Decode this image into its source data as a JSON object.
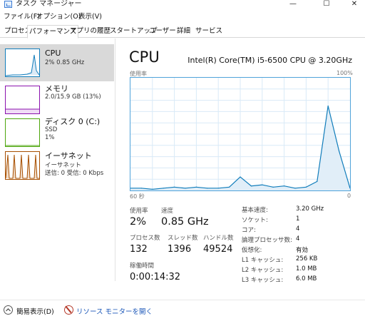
{
  "window": {
    "title": "タスク マネージャー",
    "minimize_glyph": "—",
    "maximize_glyph": "☐",
    "close_glyph": "✕"
  },
  "menu": {
    "file": "ファイル(F)",
    "options": "オプション(O)",
    "view": "表示(V)"
  },
  "tabs": [
    {
      "label": "プロセス",
      "active": false
    },
    {
      "label": "パフォーマンス",
      "active": true
    },
    {
      "label": "アプリの履歴",
      "active": false
    },
    {
      "label": "スタートアップ",
      "active": false
    },
    {
      "label": "ユーザー",
      "active": false
    },
    {
      "label": "詳細",
      "active": false
    },
    {
      "label": "サービス",
      "active": false
    }
  ],
  "sidebar": {
    "items": [
      {
        "title": "CPU",
        "sub1": "2% 0.85 GHz",
        "sub2": "",
        "color": "#117dbb",
        "icon": "cpu-graph"
      },
      {
        "title": "メモリ",
        "sub1": "2.0/15.9 GB (13%)",
        "sub2": "",
        "color": "#8b12ae",
        "icon": "memory-graph"
      },
      {
        "title": "ディスク 0 (C:)",
        "sub1": "SSD",
        "sub2": "1%",
        "color": "#4da60c",
        "icon": "disk-graph"
      },
      {
        "title": "イーサネット",
        "sub1": "イーサネット",
        "sub2": "送信: 0 受信: 0 Kbps",
        "color": "#a74f01",
        "icon": "network-graph"
      }
    ]
  },
  "main": {
    "title": "CPU",
    "cpu_model": "Intel(R) Core(TM) i5-6500 CPU @ 3.20GHz",
    "graph_top_left": "使用率",
    "graph_top_right": "100%",
    "graph_bottom_left": "60 秒",
    "graph_bottom_right": "0",
    "graph_color": "#117dbb"
  },
  "stats": {
    "usage_label": "使用率",
    "usage_value": "2%",
    "speed_label": "速度",
    "speed_value": "0.85 GHz",
    "processes_label": "プロセス数",
    "processes_value": "132",
    "threads_label": "スレッド数",
    "threads_value": "1396",
    "handles_label": "ハンドル数",
    "handles_value": "49524",
    "uptime_label": "稼働時間",
    "uptime_value": "0:00:14:32"
  },
  "specs": [
    {
      "label": "基本速度:",
      "value": "3.20 GHz"
    },
    {
      "label": "ソケット:",
      "value": "1"
    },
    {
      "label": "コア:",
      "value": "4"
    },
    {
      "label": "論理プロセッサ数:",
      "value": "4"
    },
    {
      "label": "仮想化:",
      "value": "有効"
    },
    {
      "label": "L1 キャッシュ:",
      "value": "256 KB"
    },
    {
      "label": "L2 キャッシュ:",
      "value": "1.0 MB"
    },
    {
      "label": "L3 キャッシュ:",
      "value": "6.0 MB"
    }
  ],
  "footer": {
    "compact_view": "簡易表示(D)",
    "resource_monitor": "リソース モニターを開く"
  },
  "chart_data": {
    "type": "area",
    "x": [
      60,
      57,
      54,
      51,
      48,
      45,
      42,
      39,
      36,
      33,
      30,
      27,
      24,
      21,
      18,
      15,
      12,
      9,
      6,
      3,
      0
    ],
    "series": [
      {
        "values": [
          2,
          2,
          1,
          2,
          3,
          2,
          3,
          2,
          2,
          3,
          12,
          4,
          5,
          3,
          4,
          2,
          3,
          8,
          75,
          35,
          2
        ]
      }
    ],
    "xlim": [
      60,
      0
    ],
    "ylim": [
      0,
      100
    ],
    "grid": true
  }
}
